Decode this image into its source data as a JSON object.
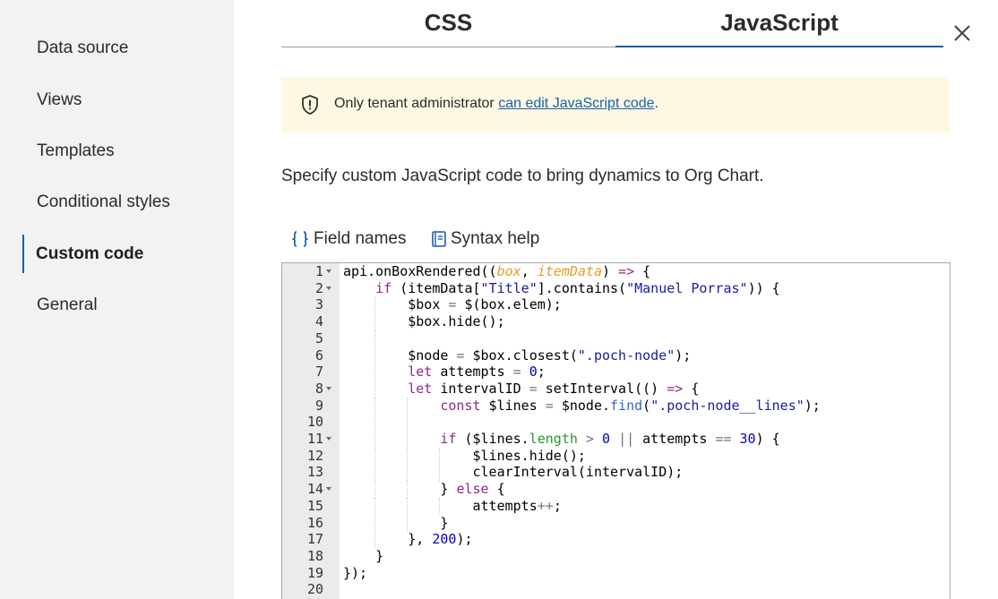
{
  "sidebar": {
    "items": [
      {
        "label": "Data source"
      },
      {
        "label": "Views"
      },
      {
        "label": "Templates"
      },
      {
        "label": "Conditional styles"
      },
      {
        "label": "Custom code",
        "active": true
      },
      {
        "label": "General"
      }
    ]
  },
  "tabs": [
    {
      "label": "CSS"
    },
    {
      "label": "JavaScript",
      "active": true
    }
  ],
  "notice": {
    "text_before": "Only tenant administrator ",
    "link": "can edit JavaScript code",
    "text_after": "."
  },
  "description": "Specify custom JavaScript code to bring dynamics to Org Chart.",
  "toolbar": {
    "field_names": "Field names",
    "syntax_help": "Syntax help"
  },
  "editor": {
    "lines": [
      "api.onBoxRendered((box, itemData) => {",
      "    if (itemData[\"Title\"].contains(\"Manuel Porras\")) {",
      "        $box = $(box.elem);",
      "        $box.hide();",
      "",
      "        $node = $box.closest(\".poch-node\");",
      "        let attempts = 0;",
      "        let intervalID = setInterval(() => {",
      "            const $lines = $node.find(\".poch-node__lines\");",
      "",
      "            if ($lines.length > 0 || attempts == 30) {",
      "                $lines.hide();",
      "                clearInterval(intervalID);",
      "            } else {",
      "                attempts++;",
      "            }",
      "        }, 200);",
      "    }",
      "});",
      ""
    ],
    "line_numbers": [
      "1",
      "2",
      "3",
      "4",
      "5",
      "6",
      "7",
      "8",
      "9",
      "10",
      "11",
      "12",
      "13",
      "14",
      "15",
      "16",
      "17",
      "18",
      "19",
      "20"
    ],
    "fold_lines": [
      1,
      2,
      8,
      11,
      14
    ]
  },
  "colors": {
    "accent": "#1e5aa8",
    "notice_bg": "#fdf8e1",
    "sidebar_bg": "#f2f2f2",
    "link": "#1a5fb4"
  }
}
